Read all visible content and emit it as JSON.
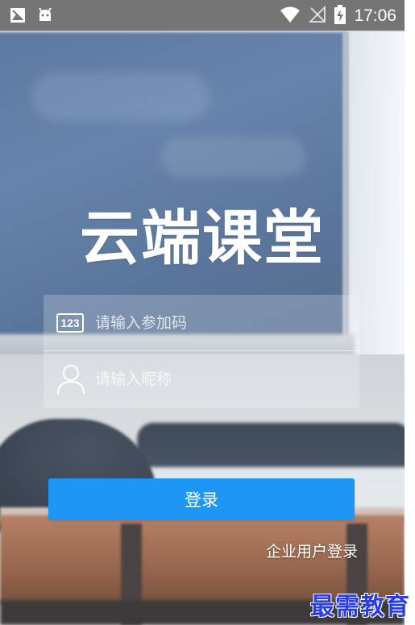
{
  "status_bar": {
    "time": "17:06",
    "left_icons": [
      "image-notification-icon",
      "android-notification-icon"
    ],
    "right_icons": [
      "wifi-icon",
      "no-signal-icon",
      "battery-charging-icon"
    ]
  },
  "app": {
    "logo_text": "云端课堂"
  },
  "form": {
    "code_icon_text": "123",
    "code_placeholder": "请输入参加码",
    "nickname_placeholder": "请输入昵称"
  },
  "actions": {
    "login_label": "登录",
    "enterprise_login_label": "企业用户登录"
  },
  "watermark": {
    "text": "最需教育"
  },
  "colors": {
    "primary_button": "#1e96f6",
    "status_bar": "#757575",
    "watermark": "#2a3de0"
  }
}
